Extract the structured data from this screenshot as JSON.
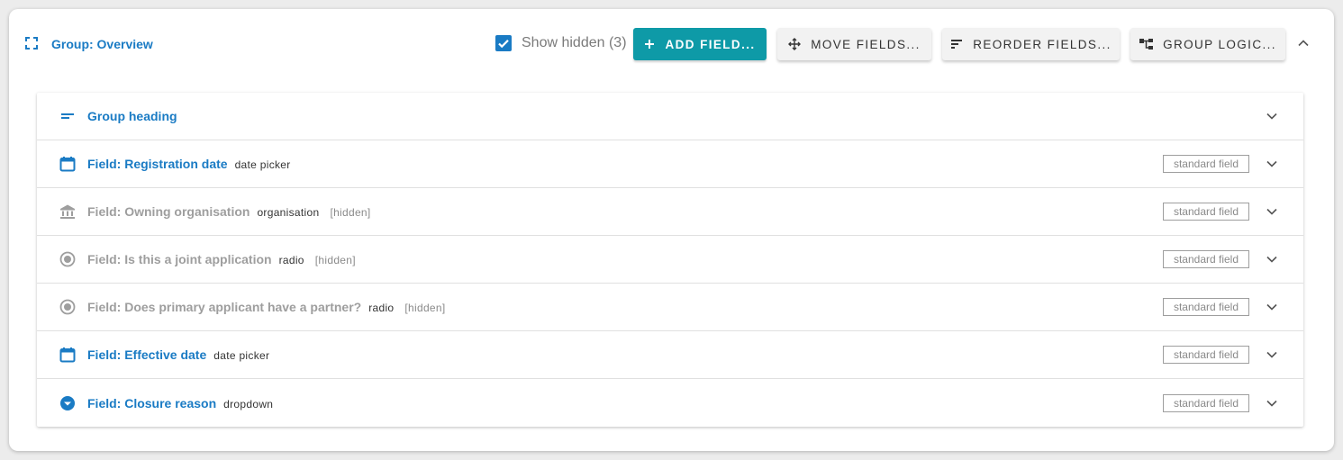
{
  "group": {
    "title": "Group: Overview",
    "show_hidden_label": "Show hidden (3)",
    "show_hidden_checked": true
  },
  "toolbar": {
    "add_field_label": "ADD FIELD...",
    "move_fields_label": "MOVE FIELDS...",
    "reorder_fields_label": "REORDER FIELDS...",
    "group_logic_label": "GROUP LOGIC..."
  },
  "rows": [
    {
      "icon": "short-text-icon",
      "title": "Group heading",
      "type": "",
      "hidden": "",
      "badge": ""
    },
    {
      "icon": "calendar-icon",
      "title": "Field: Registration date",
      "type": "date picker",
      "hidden": "",
      "badge": "standard field"
    },
    {
      "icon": "bank-icon",
      "title": "Field: Owning organisation",
      "type": "organisation",
      "hidden": "[hidden]",
      "badge": "standard field"
    },
    {
      "icon": "radio-button-icon",
      "title": "Field: Is this a joint application",
      "type": "radio",
      "hidden": "[hidden]",
      "badge": "standard field"
    },
    {
      "icon": "radio-button-icon",
      "title": "Field: Does primary applicant have a partner?",
      "type": "radio",
      "hidden": "[hidden]",
      "badge": "standard field"
    },
    {
      "icon": "calendar-icon",
      "title": "Field: Effective date",
      "type": "date picker",
      "hidden": "",
      "badge": "standard field"
    },
    {
      "icon": "dropdown-circle-icon",
      "title": "Field: Closure reason",
      "type": "dropdown",
      "hidden": "",
      "badge": "standard field"
    }
  ],
  "colors": {
    "accent": "#1a7bc4",
    "primary_button": "#0e9aa7",
    "hidden_text": "#9e9e9e"
  }
}
